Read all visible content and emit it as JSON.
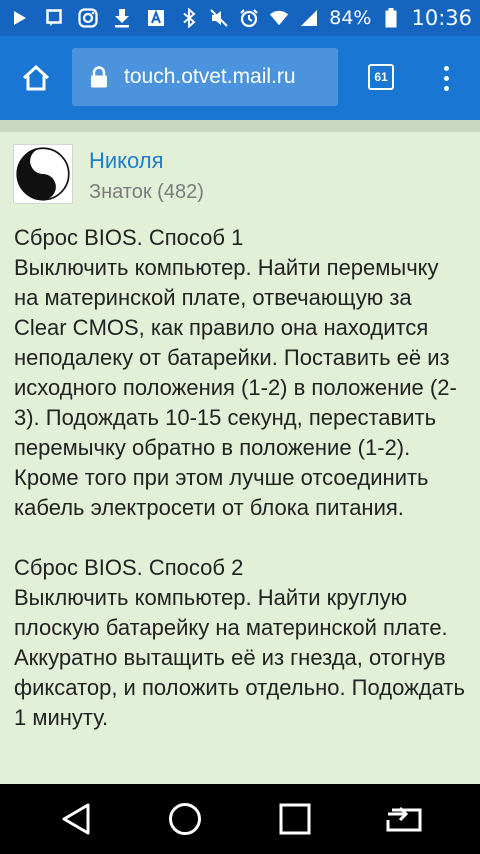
{
  "status_bar": {
    "battery": "84%",
    "time": "10:36",
    "left_icons": [
      "play-store-icon",
      "square-notification-icon",
      "instagram-icon",
      "download-icon",
      "text-icon"
    ],
    "right_icons": [
      "bluetooth-icon",
      "mute-icon",
      "alarm-icon",
      "wifi-icon",
      "signal-icon",
      "battery-icon"
    ]
  },
  "toolbar": {
    "url": "touch.otvet.mail.ru",
    "tab_count": "61"
  },
  "answer": {
    "author_name": "Николя",
    "author_rank": "Знаток (482)",
    "text": "Сброс BIOS. Способ 1\nВыключить компьютер. Найти перемычку на материнской плате, отвечающую за Clear CMOS, как правило она находится неподалеку от батарейки. Поставить её из исходного положения (1-2) в положение (2-3). Подождать 10-15 секунд, переставить перемычку обратно в положение (1-2). Кроме того при этом лучше отсоединить кабель электросети от блока питания.\n\nСброс BIOS. Способ 2\nВыключить компьютер. Найти круглую плоскую батарейку на материнской плате. Аккуратно вытащить её из гнезда, отогнув фиксатор, и положить отдельно. Подождать 1 минуту."
  },
  "colors": {
    "status_bar": "#1565c0",
    "toolbar": "#1976d2",
    "url_box": "#4c93de",
    "page_background": "#e3f0d8",
    "author_link": "#1e7fc8"
  },
  "nav_bar": {
    "buttons": [
      "back-icon",
      "home-icon",
      "recents-icon",
      "cast-icon"
    ]
  }
}
